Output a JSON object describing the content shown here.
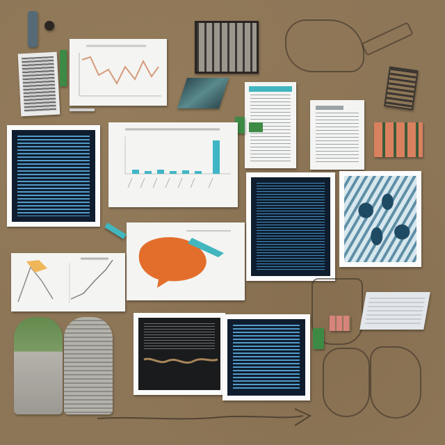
{
  "colors": {
    "board": "#8d7657",
    "screen_bg": "#0f1d2e",
    "screen_text": "#5fb2e6",
    "paper": "#f4f4f2",
    "chart_line": "#d59b7a",
    "chart_bar": "#3fb5c6",
    "orange_shape": "#e36e2c",
    "teal_accent": "#42b6bf",
    "green_accent": "#3d8a45"
  },
  "icons": [
    "bottle-icon",
    "grill-icon",
    "engine-sketch-icon",
    "pen-icon",
    "fan-icon",
    "photo-stack-icon",
    "cactus-icon",
    "fish-sketch-icon",
    "arrow-sketch-icon"
  ]
}
